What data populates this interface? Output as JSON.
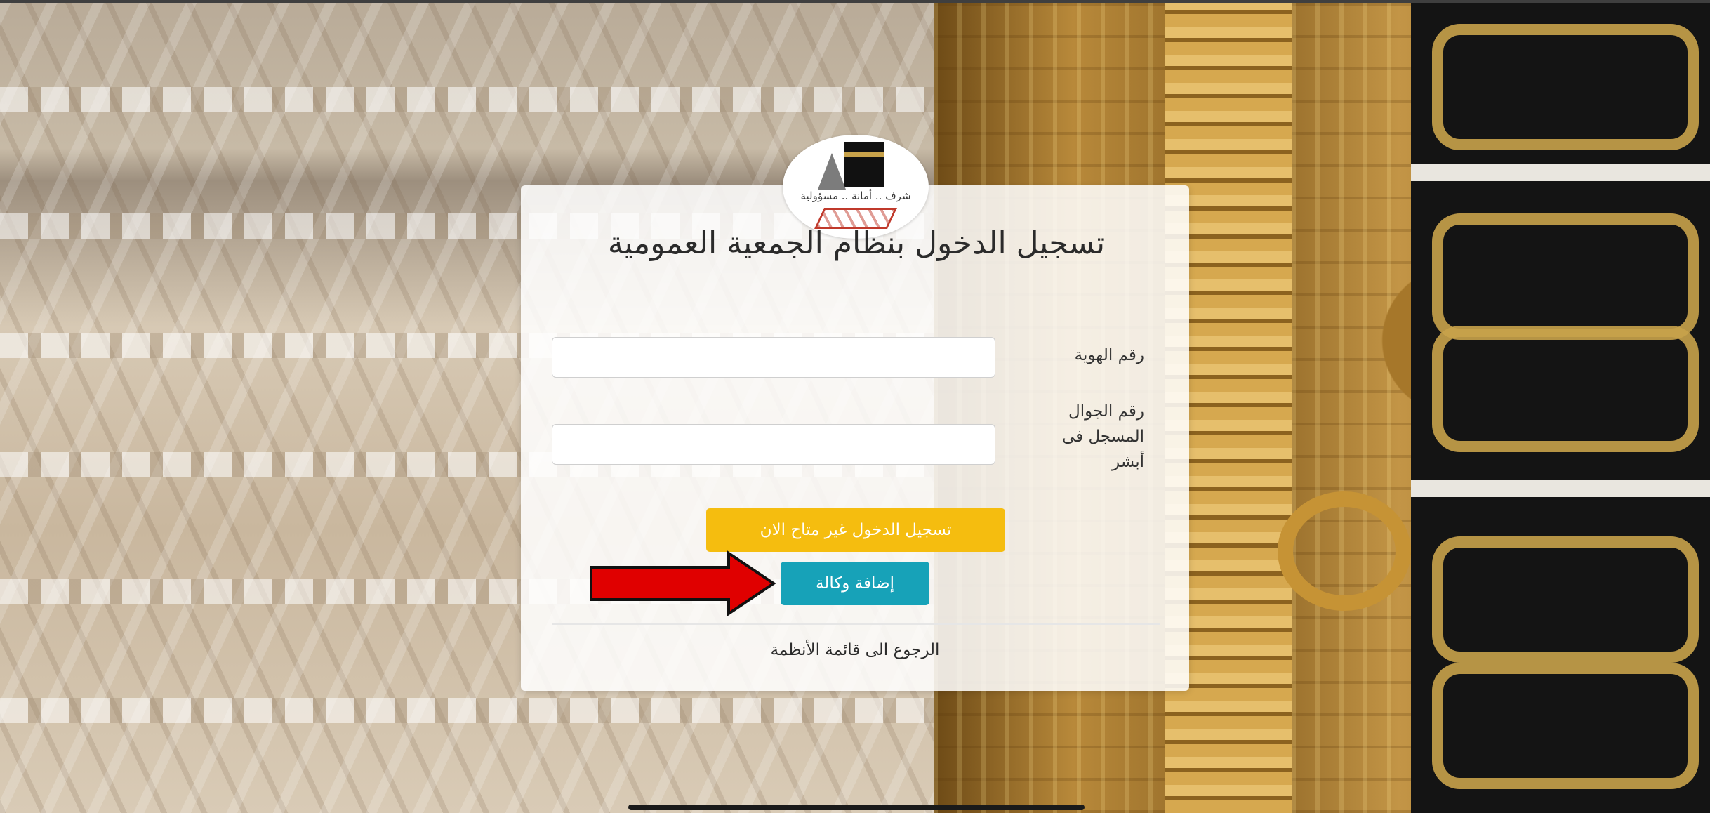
{
  "login": {
    "title": "تسجيل الدخول بنظام الجمعية العمومية",
    "id_label": "رقم الهوية",
    "id_value": "",
    "mobile_label": "رقم الجوال المسجل فى أبشر",
    "mobile_value": "",
    "login_button_label": "تسجيل الدخول غير متاح الان",
    "add_agency_button_label": "إضافة وكالة",
    "back_link_label": "الرجوع الى قائمة الأنظمة"
  },
  "logo": {
    "emblem_text": "شرف .. أمانة .. مسؤولية"
  },
  "colors": {
    "login_button": "#f5bd0f",
    "add_agency_button": "#17a2b8",
    "annotation_arrow": "#e00000"
  },
  "icons": {
    "logo": "kaaba-emblem-icon",
    "annotation": "red-arrow-right-icon"
  }
}
